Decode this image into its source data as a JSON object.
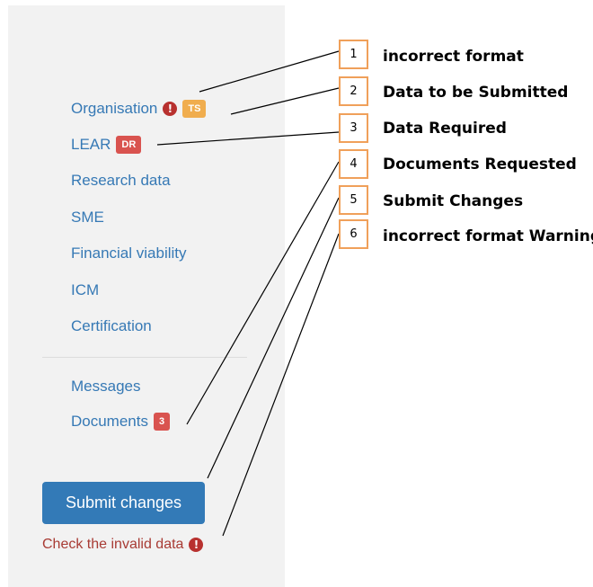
{
  "sidebar": {
    "items": [
      {
        "label": "Organisation",
        "badge": "TS"
      },
      {
        "label": "LEAR",
        "badge": "DR"
      },
      {
        "label": "Research data"
      },
      {
        "label": "SME"
      },
      {
        "label": "Financial viability"
      },
      {
        "label": "ICM"
      },
      {
        "label": "Certification"
      }
    ],
    "secondary_items": [
      {
        "label": "Messages"
      },
      {
        "label": "Documents",
        "badge": "3"
      }
    ],
    "submit_label": "Submit changes",
    "warning_text": "Check the invalid data",
    "alert_icon_glyph": "!"
  },
  "callouts": [
    {
      "number": "1",
      "label": "incorrect format"
    },
    {
      "number": "2",
      "label": "Data to be Submitted"
    },
    {
      "number": "3",
      "label": "Data Required"
    },
    {
      "number": "4",
      "label": "Documents Requested"
    },
    {
      "number": "5",
      "label": "Submit Changes"
    },
    {
      "number": "6",
      "label": "incorrect format Warning"
    }
  ],
  "colors": {
    "link": "#3679b5",
    "badge_orange": "#f0ad4e",
    "badge_red": "#d9534f",
    "alert": "#b8312f",
    "primary_button": "#337ab7",
    "warning_text": "#a83b34",
    "callout_border": "#f0a05a"
  },
  "icons": {
    "alert": "exclamation-circle-icon"
  }
}
